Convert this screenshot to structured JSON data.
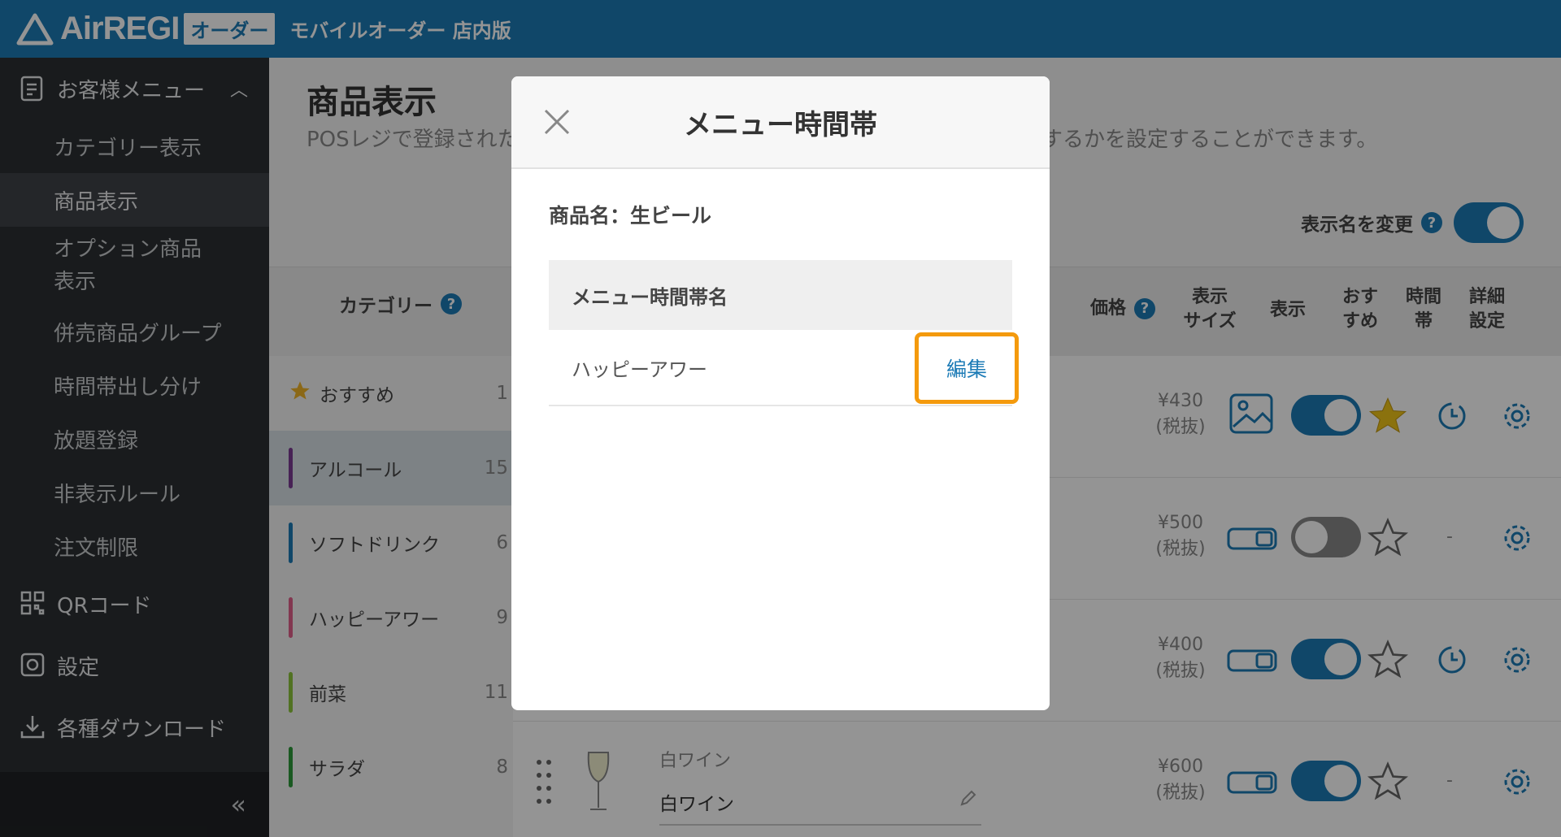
{
  "header": {
    "brand": "AirREGI",
    "badge": "オーダー",
    "subtitle": "モバイルオーダー 店内版"
  },
  "sidebar": {
    "section_menu": "お客様メニュー",
    "items": [
      {
        "label": "カテゴリー表示"
      },
      {
        "label": "商品表示",
        "active": true
      },
      {
        "label": "オプション商品表示"
      },
      {
        "label": "併売商品グループ"
      },
      {
        "label": "時間帯出し分け"
      },
      {
        "label": "放題登録"
      },
      {
        "label": "非表示ルール"
      },
      {
        "label": "注文制限"
      }
    ],
    "item_option_line1": "オプション商品",
    "item_option_line2": "表示",
    "section_qr": "QRコード",
    "section_settings": "設定",
    "section_download": "各種ダウンロード",
    "collapse_glyph": "«"
  },
  "main": {
    "title": "商品表示",
    "desc_left": "POSレジで登録された",
    "desc_right": "するかを設定することができます。",
    "rename_label": "表示名を変更",
    "category_header": "カテゴリー",
    "col_price": "価格",
    "col_size_1": "表示",
    "col_size_2": "サイズ",
    "col_display": "表示",
    "col_reco_1": "おす",
    "col_reco_2": "すめ",
    "col_time_1": "時間",
    "col_time_2": "帯",
    "col_detail_1": "詳細",
    "col_detail_2": "設定",
    "categories": [
      {
        "name": "おすすめ",
        "count": "1",
        "color": "#f0b428"
      },
      {
        "name": "アルコール",
        "count": "15",
        "color": "#7a3b93"
      },
      {
        "name": "ソフトドリンク",
        "count": "6",
        "color": "#1c7bb6"
      },
      {
        "name": "ハッピーアワー",
        "count": "9",
        "color": "#e0608a"
      },
      {
        "name": "前菜",
        "count": "11",
        "color": "#8cc43c"
      },
      {
        "name": "サラダ",
        "count": "8",
        "color": "#2e9a3a"
      }
    ],
    "products": [
      {
        "price": "¥430",
        "tax": "(税抜)",
        "size": "image",
        "display": true,
        "reco": true,
        "time": true
      },
      {
        "price": "¥500",
        "tax": "(税抜)",
        "size": "small",
        "display": false,
        "reco": false,
        "time": false
      },
      {
        "price": "¥400",
        "tax": "(税抜)",
        "size": "small",
        "display": true,
        "reco": false,
        "time": true
      },
      {
        "price": "¥600",
        "tax": "(税抜)",
        "size": "small",
        "display": true,
        "reco": false,
        "time": false
      }
    ],
    "dash": "-",
    "wine_label_top": "白ワイン",
    "wine_label_name": "白ワイン"
  },
  "modal": {
    "title": "メニュー時間帯",
    "product_name": "商品名：生ビール",
    "table_header": "メニュー時間帯名",
    "rows": [
      {
        "name": "ハッピーアワー",
        "action": "編集"
      }
    ]
  },
  "colors": {
    "brand": "#1c7bb6",
    "highlight": "#f49a0d",
    "star": "#f0c419"
  }
}
